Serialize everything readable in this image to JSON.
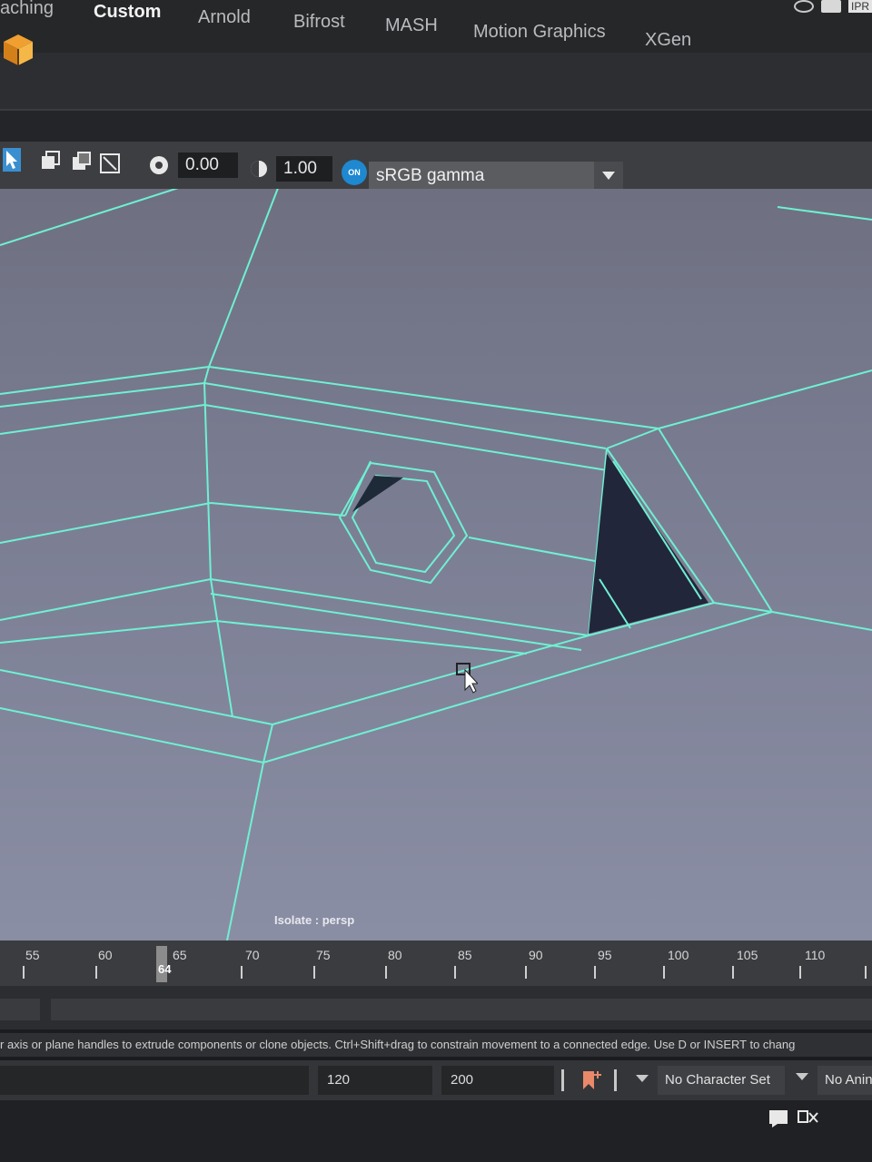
{
  "shelf": {
    "tabs": [
      "aching",
      "Custom",
      "Arnold",
      "Bifrost",
      "MASH",
      "Motion Graphics",
      "XGen"
    ],
    "active_tab": "Custom",
    "ipr_label": "IPR"
  },
  "viewport_toolbar": {
    "exposure_value": "0.00",
    "gamma_value": "1.00",
    "color_management_toggle": "ON",
    "view_transform": "sRGB gamma",
    "accent_color": "#1e88d0"
  },
  "viewport": {
    "isolate_label": "Isolate : persp",
    "wire_color": "#6ff0d2"
  },
  "time_slider": {
    "ticks": [
      "55",
      "60",
      "65",
      "70",
      "75",
      "80",
      "85",
      "90",
      "95",
      "100",
      "105",
      "110"
    ],
    "current_frame": "64"
  },
  "help_line": "r axis or plane handles to extrude components or clone objects. Ctrl+Shift+drag to constrain movement to a connected edge. Use D or INSERT to chang",
  "playback": {
    "range_end": "120",
    "anim_end": "200",
    "character_set": "No Character Set",
    "anim_layer": "No Anin"
  }
}
